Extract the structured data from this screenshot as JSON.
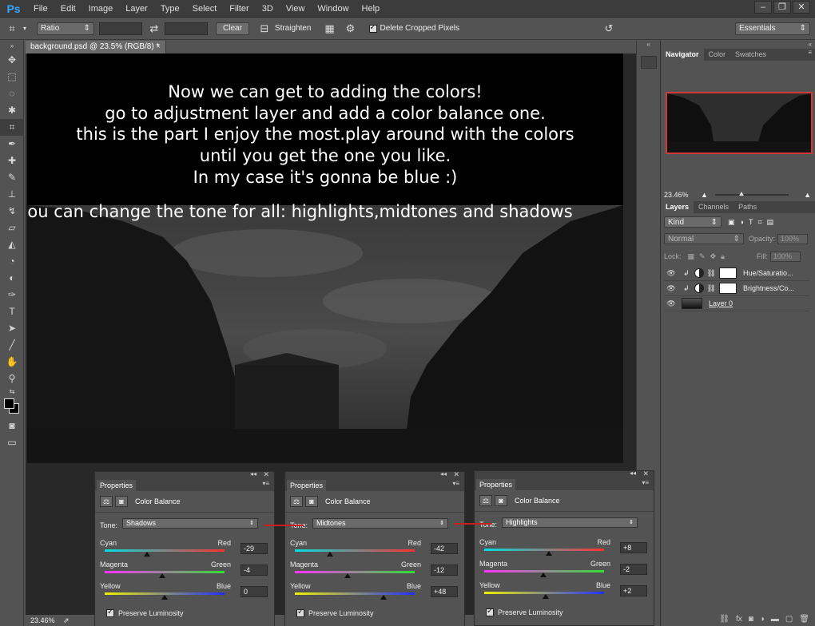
{
  "app": {
    "name": "Ps"
  },
  "menu": [
    "File",
    "Edit",
    "Image",
    "Layer",
    "Type",
    "Select",
    "Filter",
    "3D",
    "View",
    "Window",
    "Help"
  ],
  "options": {
    "ratio_label": "Ratio",
    "clear_label": "Clear",
    "straighten_label": "Straighten",
    "delete_cropped_label": "Delete Cropped Pixels",
    "workspace_label": "Essentials"
  },
  "document": {
    "tab_title": "background.psd @ 23.5% (RGB/8) *",
    "zoom": "23.46%"
  },
  "tutorial": {
    "lines": [
      "Now we can get to adding the colors!",
      "go to adjustment layer and add a color balance one.",
      "this is the part I enjoy the most.play around with the colors",
      "until you get the one you like.",
      "In my case it's gonna be blue :)"
    ],
    "tone_note": "you can change the tone for all: highlights,midtones and shadows"
  },
  "navigator": {
    "tabs": [
      "Navigator",
      "Color",
      "Swatches"
    ],
    "zoom": "23.46%"
  },
  "layers_panel": {
    "tabs": [
      "Layers",
      "Channels",
      "Paths"
    ],
    "kind_label": "Kind",
    "blend_mode": "Normal",
    "opacity_label": "Opacity:",
    "opacity_value": "100%",
    "lock_label": "Lock:",
    "fill_label": "Fill:",
    "fill_value": "100%",
    "layers": [
      {
        "name": "Hue/Saturatio..."
      },
      {
        "name": "Brightness/Co..."
      },
      {
        "name": "Layer 0"
      }
    ]
  },
  "properties_panels": [
    {
      "tab": "Properties",
      "title": "Color Balance",
      "tone_label": "Tone:",
      "tone": "Shadows",
      "sliders": [
        {
          "left": "Cyan",
          "right": "Red",
          "value": "-29",
          "level": -29
        },
        {
          "left": "Magenta",
          "right": "Green",
          "value": "-4",
          "level": -4
        },
        {
          "left": "Yellow",
          "right": "Blue",
          "value": "0",
          "level": 0
        }
      ],
      "preserve_label": "Preserve Luminosity"
    },
    {
      "tab": "Properties",
      "title": "Color Balance",
      "tone_label": "Tone:",
      "tone": "Midtones",
      "sliders": [
        {
          "left": "Cyan",
          "right": "Red",
          "value": "-42",
          "level": -42
        },
        {
          "left": "Magenta",
          "right": "Green",
          "value": "-12",
          "level": -12
        },
        {
          "left": "Yellow",
          "right": "Blue",
          "value": "+48",
          "level": 48
        }
      ],
      "preserve_label": "Preserve Luminosity"
    },
    {
      "tab": "Properties",
      "title": "Color Balance",
      "tone_label": "Tone:",
      "tone": "Highlights",
      "sliders": [
        {
          "left": "Cyan",
          "right": "Red",
          "value": "+8",
          "level": 8
        },
        {
          "left": "Magenta",
          "right": "Green",
          "value": "-2",
          "level": -2
        },
        {
          "left": "Yellow",
          "right": "Blue",
          "value": "+2",
          "level": 2
        }
      ],
      "preserve_label": "Preserve Luminosity"
    }
  ],
  "colors": {
    "accent": "#31a8ff",
    "highlight_red": "#c81e1e"
  }
}
